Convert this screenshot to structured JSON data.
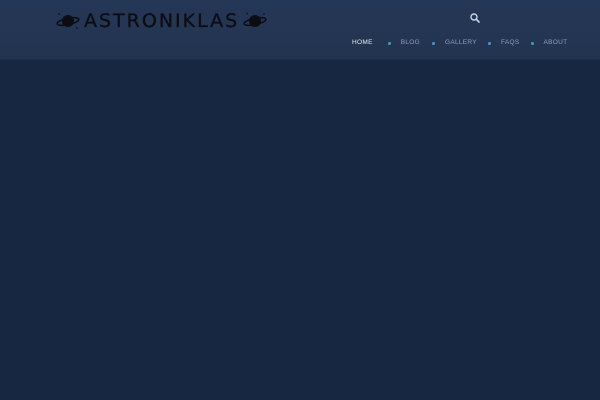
{
  "header": {
    "logo": {
      "text": "ASTRONIKLAS",
      "left_icon": "saturn-icon",
      "right_icon": "saturn-icon"
    },
    "search_icon": "search-icon"
  },
  "nav": {
    "items": [
      {
        "label": "HOME",
        "active": true
      },
      {
        "label": "BLOG",
        "active": false
      },
      {
        "label": "GALLERY",
        "active": false
      },
      {
        "label": "FAQS",
        "active": false
      },
      {
        "label": "ABOUT",
        "active": false
      }
    ],
    "separator_icon": "dot-icon"
  },
  "colors": {
    "page_background": "#172641",
    "header_background": "#243653",
    "nav_text": "#8ea1c4",
    "nav_active_text": "#e7edf7",
    "separator_dot": "#3d9dc6",
    "logo_text": "#0c0c14"
  }
}
